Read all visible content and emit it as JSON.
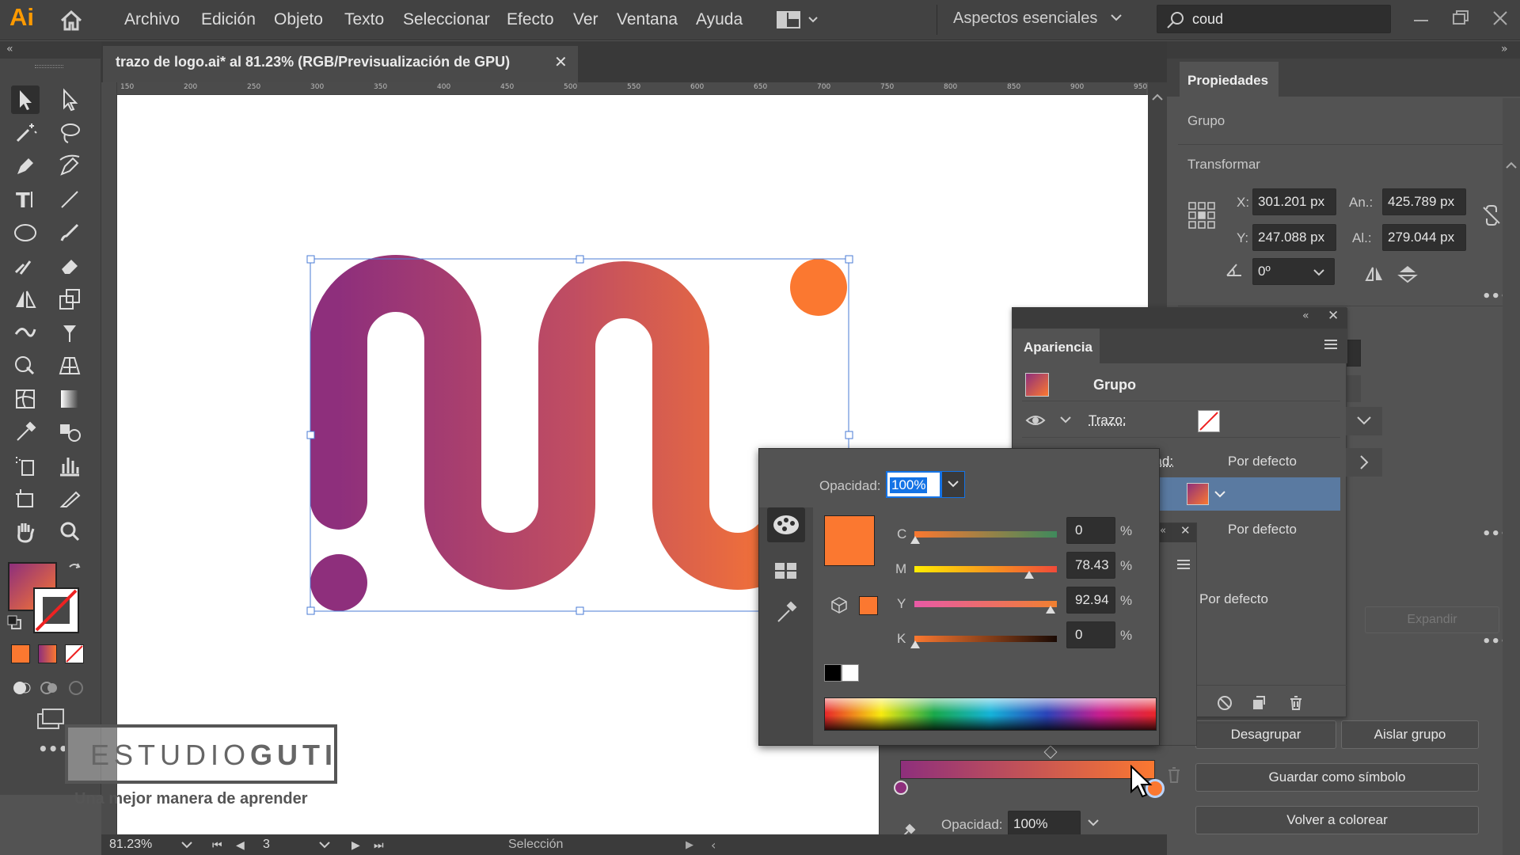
{
  "app": {
    "logo": "Ai",
    "home_icon": "home-icon"
  },
  "menu": [
    "Archivo",
    "Edición",
    "Objeto",
    "Texto",
    "Seleccionar",
    "Efecto",
    "Ver",
    "Ventana",
    "Ayuda"
  ],
  "workspace": "Aspectos esenciales",
  "search": {
    "value": "coud"
  },
  "document": {
    "tab_title": "trazo de logo.ai* al 81.23% (RGB/Previsualización de GPU)"
  },
  "ruler": {
    "ticks": [
      "150",
      "200",
      "250",
      "300",
      "350",
      "400",
      "450",
      "500",
      "550",
      "600",
      "650",
      "700",
      "750",
      "800",
      "850",
      "900",
      "950"
    ]
  },
  "properties": {
    "tab": "Propiedades",
    "selection": "Grupo",
    "transform_title": "Transformar",
    "x_label": "X:",
    "x": "301.201 px",
    "y_label": "Y:",
    "y": "247.088 px",
    "w_label": "An.:",
    "w": "425.789 px",
    "h_label": "Al.:",
    "h": "279.044 px",
    "angle": "0º",
    "expand": "Expandir",
    "ungroup": "Desagrupar",
    "isolate": "Aislar grupo",
    "save_symbol": "Guardar como símbolo",
    "recolor": "Volver a colorear"
  },
  "appearance": {
    "tab": "Apariencia",
    "group": "Grupo",
    "stroke": "Trazo:",
    "opacity_partial": "dad:",
    "default1": "Por defecto",
    "default2": "Por defecto",
    "default3": "Por defecto"
  },
  "color": {
    "opacity_label": "Opacidad:",
    "opacity": "100%",
    "c_label": "C",
    "c": "0",
    "m_label": "M",
    "m": "78.43",
    "y_label": "Y",
    "y": "92.94",
    "k_label": "K",
    "k": "0",
    "percent": "%",
    "swatch": "#fb7830"
  },
  "gradient": {
    "opacity_label": "Opacidad:",
    "opacity": "100%"
  },
  "status": {
    "zoom": "81.23%",
    "artboard": "3",
    "tool": "Selección"
  },
  "watermark": {
    "brand_light": "ESTUDIO",
    "brand_bold": "GUTI",
    "tagline": "Una mejor manera de aprender"
  },
  "colors": {
    "grad_start": "#8e2f7c",
    "grad_end": "#fb7830",
    "accent": "#1473e6"
  }
}
